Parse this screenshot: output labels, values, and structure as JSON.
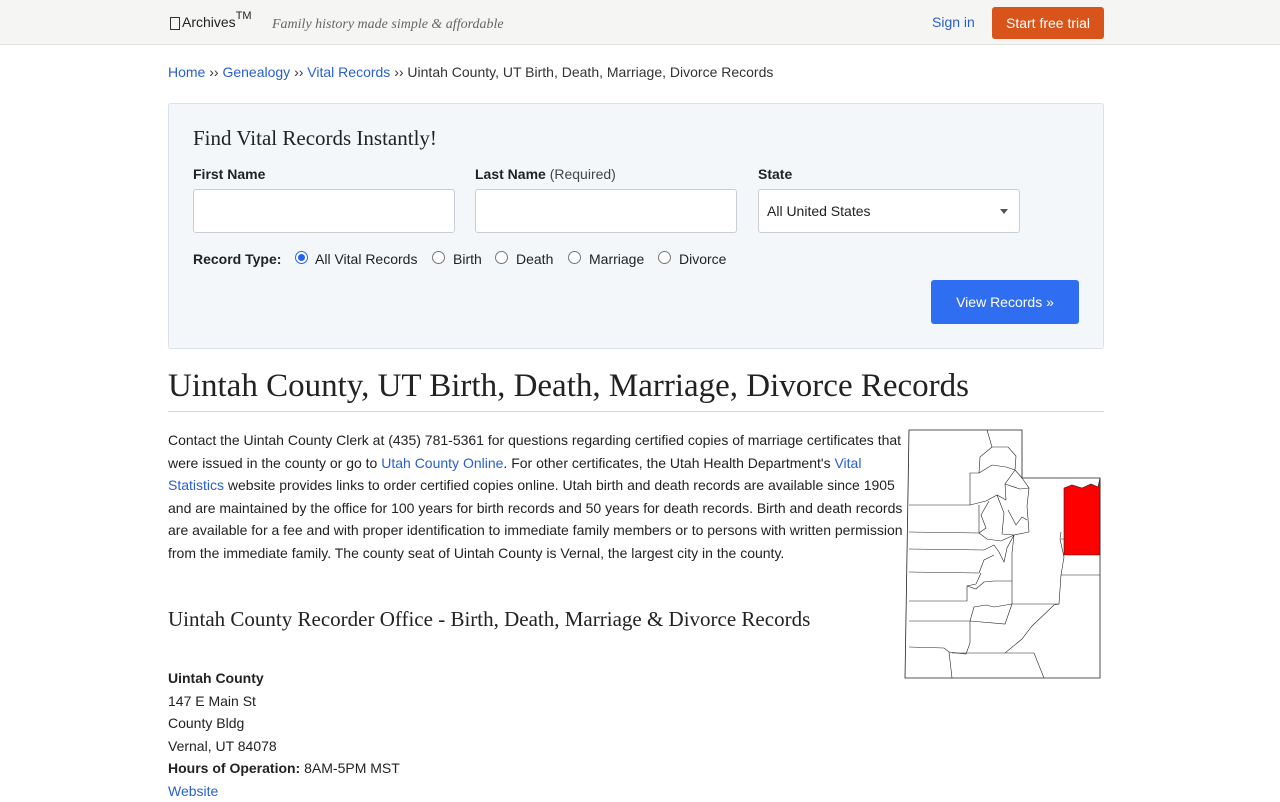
{
  "header": {
    "logo_text": "Archives",
    "logo_tm": "TM",
    "tagline": "Family history made simple & affordable",
    "signin_label": "Sign in",
    "trial_label": "Start free trial"
  },
  "breadcrumb": {
    "items": [
      "Home",
      "Genealogy",
      "Vital Records"
    ],
    "separator": "››",
    "current": "Uintah County, UT Birth, Death, Marriage, Divorce Records"
  },
  "search": {
    "title": "Find Vital Records Instantly!",
    "first_name_label": "First Name",
    "last_name_label": "Last Name",
    "last_name_required": "(Required)",
    "state_label": "State",
    "first_name_value": "",
    "last_name_value": "",
    "state_value": "All United States",
    "record_type_label": "Record Type:",
    "record_types": [
      "All Vital Records",
      "Birth",
      "Death",
      "Marriage",
      "Divorce"
    ],
    "selected_record_type": "All Vital Records",
    "submit_label": "View Records »"
  },
  "main": {
    "title": "Uintah County, UT Birth, Death, Marriage, Divorce Records",
    "intro_part1": "Contact the Uintah County Clerk at (435) 781-5361 for questions regarding certified copies of marriage certificates that were issued in the county or go to ",
    "intro_link1": "Utah County Online",
    "intro_part2": ". For other certificates, the Utah Health Department's ",
    "intro_link2": "Vital Statistics",
    "intro_part3": " website provides links to order certified copies online. Utah birth and death records are available since 1905 and are maintained by the office for 100 years for birth records and 50 years for death records. Birth and death records are available for a fee and with proper identification to immediate family members or to persons with written permission from the immediate family. The county seat of Uintah County is Vernal, the largest city in the county.",
    "section_title": "Uintah County Recorder Office - Birth, Death, Marriage & Divorce Records"
  },
  "office": {
    "name": "Uintah County",
    "address1": "147 E Main St",
    "address2": "County Bldg",
    "city_state_zip": "Vernal, UT 84078",
    "hours_label": "Hours of Operation:",
    "hours_value": "8AM-5PM MST",
    "website_label": "Website"
  },
  "colors": {
    "accent": "#2f6ef0",
    "trial_button": "#d8541a",
    "link": "#2a5fd0",
    "highlight_county": "#ff0000"
  }
}
